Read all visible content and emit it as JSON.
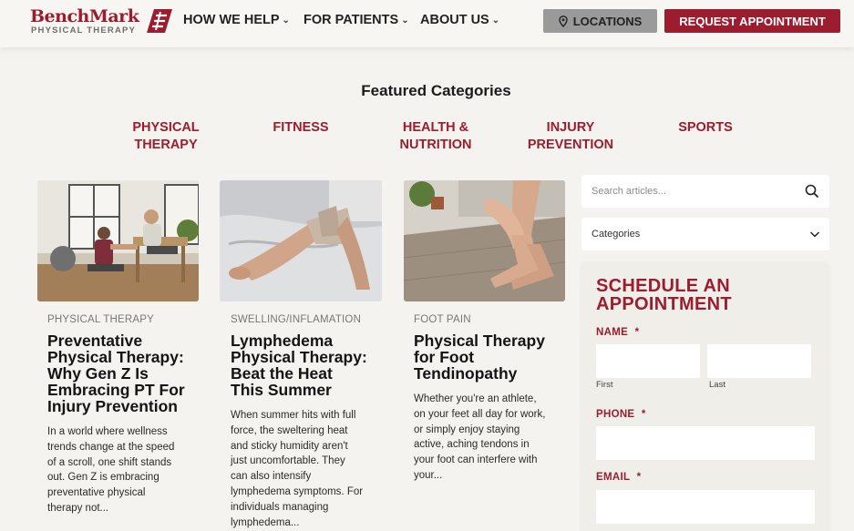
{
  "header": {
    "logo_text": "BenchMark",
    "logo_sub": "PHYSICAL THERAPY",
    "nav": [
      {
        "label": "HOW WE HELP"
      },
      {
        "label": "FOR PATIENTS"
      },
      {
        "label": "ABOUT US"
      }
    ],
    "locations_label": "LOCATIONS",
    "request_label": "REQUEST APPOINTMENT"
  },
  "featured": {
    "title": "Featured Categories",
    "categories": [
      {
        "line1": "PHYSICAL",
        "line2": "THERAPY"
      },
      {
        "line1": "FITNESS",
        "line2": ""
      },
      {
        "line1": "HEALTH &",
        "line2": "NUTRITION"
      },
      {
        "line1": "INJURY",
        "line2": "PREVENTION"
      },
      {
        "line1": "SPORTS",
        "line2": ""
      }
    ]
  },
  "articles": [
    {
      "tag": "PHYSICAL THERAPY",
      "title_lines": [
        "Preventative",
        "Physical Therapy:",
        "Why Gen Z Is",
        "Embracing PT For",
        "Injury Prevention"
      ],
      "excerpt_lines": [
        "In a world where wellness",
        "trends change at the speed",
        "of a scroll, one shift stands",
        "out. Gen Z is embracing",
        "preventative physical",
        "therapy not..."
      ]
    },
    {
      "tag": "SWELLING/INFLAMATION",
      "title_lines": [
        "Lymphedema",
        "Physical Therapy:",
        "Beat the Heat",
        "This Summer"
      ],
      "excerpt_lines": [
        "When summer hits with full",
        "force, the sweltering heat",
        "and sticky humidity aren't",
        "just uncomfortable. They",
        "can also intensify",
        "lymphedema symptoms. For",
        "individuals managing",
        "lymphedema..."
      ]
    },
    {
      "tag": "FOOT PAIN",
      "title_lines": [
        "Physical Therapy",
        "for Foot",
        "Tendinopathy"
      ],
      "excerpt_lines": [
        "Whether you're an athlete,",
        "on your feet all day for work,",
        "or simply enjoy staying",
        "active, aching tendons in",
        "your foot can interfere with",
        "your..."
      ]
    }
  ],
  "sidebar": {
    "search_placeholder": "Search articles...",
    "categories_label": "Categories",
    "schedule": {
      "title_line1": "SCHEDULE AN",
      "title_line2": "APPOINTMENT",
      "name_label": "NAME",
      "required_mark": "*",
      "first_hint": "First",
      "last_hint": "Last",
      "phone_label": "PHONE",
      "email_label": "EMAIL"
    }
  },
  "colors": {
    "brand": "#9b1d2f",
    "background": "#f4f3ef"
  }
}
